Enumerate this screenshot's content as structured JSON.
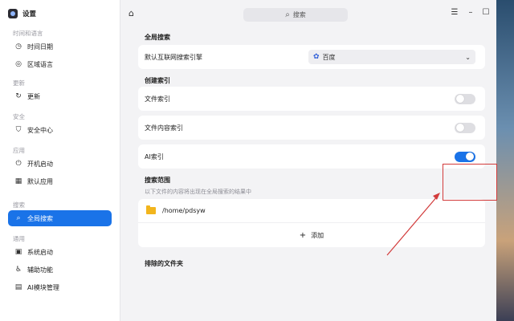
{
  "app": {
    "title": "设置"
  },
  "sidebar": {
    "groups": [
      {
        "label": "时间和语言",
        "items": [
          {
            "label": "时间日期",
            "icon": "clock-icon"
          },
          {
            "label": "区域语言",
            "icon": "globe-icon"
          }
        ]
      },
      {
        "label": "更新",
        "items": [
          {
            "label": "更新",
            "icon": "refresh-icon"
          }
        ]
      },
      {
        "label": "安全",
        "items": [
          {
            "label": "安全中心",
            "icon": "shield-icon"
          }
        ]
      },
      {
        "label": "应用",
        "items": [
          {
            "label": "开机启动",
            "icon": "power-icon"
          },
          {
            "label": "默认应用",
            "icon": "grid-icon"
          }
        ]
      },
      {
        "label": "搜索",
        "items": [
          {
            "label": "全局搜索",
            "icon": "search-icon",
            "active": true
          }
        ]
      },
      {
        "label": "通用",
        "items": [
          {
            "label": "系统启动",
            "icon": "boot-icon"
          },
          {
            "label": "辅助功能",
            "icon": "accessibility-icon"
          },
          {
            "label": "AI模块管理",
            "icon": "ai-module-icon"
          }
        ]
      }
    ]
  },
  "topbar": {
    "search_placeholder": "搜索"
  },
  "main": {
    "global_search_title": "全局搜索",
    "default_engine_label": "默认互联网搜索引擎",
    "default_engine_value": "百度",
    "create_index_title": "创建索引",
    "file_index_label": "文件索引",
    "file_index_on": false,
    "content_index_label": "文件内容索引",
    "content_index_on": false,
    "ai_index_label": "AI索引",
    "ai_index_on": true,
    "search_scope_title": "搜索范围",
    "search_scope_hint": "以下文件的内容将出现在全局搜索的结果中",
    "folder_path": "/home/pdsyw",
    "add_label": "添加",
    "excluded_title": "排除的文件夹"
  },
  "colors": {
    "accent": "#1a73e8",
    "annotation": "#d23b3b"
  }
}
